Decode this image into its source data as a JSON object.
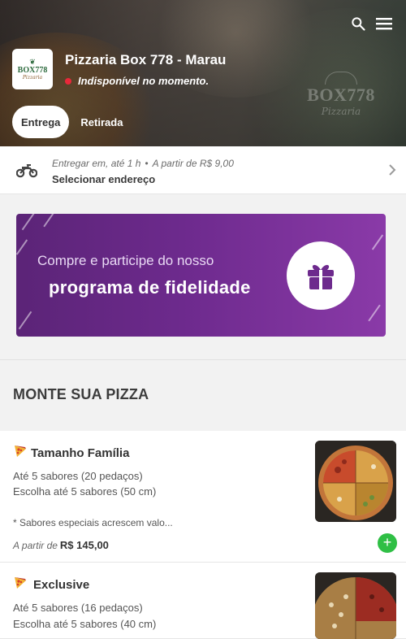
{
  "store": {
    "name": "Pizzaria Box 778 - Marau",
    "status_text": "Indisponível no momento.",
    "status_color": "#e8283a",
    "logo_name": "BOX778",
    "logo_sub": "Pizzaria",
    "watermark_name": "BOX778",
    "watermark_sub": "Pizzaria"
  },
  "toggle": {
    "delivery_label": "Entrega",
    "pickup_label": "Retirada",
    "selected": "Entrega"
  },
  "delivery": {
    "eta_text": "Entregar em, até 1 h",
    "separator": "•",
    "min_text": "A partir de R$ 9,00",
    "address_label": "Selecionar endereço"
  },
  "banner": {
    "line1": "Compre e participe do nosso",
    "line2": "programa de fidelidade",
    "color": "#6d2a8d"
  },
  "section": {
    "title": "MONTE SUA PIZZA"
  },
  "products": [
    {
      "title": "Tamanho Família",
      "desc1": "Até 5 sabores (20 pedaços)",
      "desc2": "Escolha até 5 sabores (50 cm)",
      "note": "* Sabores especiais acrescem valo...",
      "price_prefix": "A partir de",
      "price": "R$ 145,00",
      "add_label": "+"
    },
    {
      "title": "Exclusive",
      "desc1": "Até 5 sabores (16 pedaços)",
      "desc2": "Escolha até 5 sabores (40 cm)"
    }
  ],
  "colors": {
    "accent_green": "#2fbf45",
    "text_dark": "#3c3c3c"
  }
}
